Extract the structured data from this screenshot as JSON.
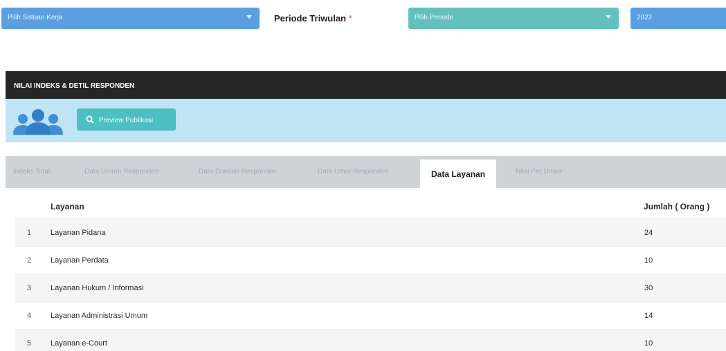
{
  "filters": {
    "unit_select": "Pilih Satuan Kerja",
    "period_label": "Periode Triwulan",
    "required_mark": "*",
    "period_select": "Pilih Periode",
    "year_select": "2022"
  },
  "panel": {
    "title": "NILAI INDEKS & DETIL RESPONDEN",
    "preview_button": "Preview Publikasi"
  },
  "tabs": [
    {
      "label": "Indeks Total"
    },
    {
      "label": "Data Umum Responden"
    },
    {
      "label": "Data Domisili Responden"
    },
    {
      "label": "Data Umur Responden"
    },
    {
      "label": "Data Layanan"
    },
    {
      "label": "Nilai Per Unsur"
    }
  ],
  "table": {
    "headers": {
      "name": "Layanan",
      "count": "Jumlah ( Orang )"
    },
    "rows": [
      {
        "no": "1",
        "name": "Layanan Pidana",
        "count": "24"
      },
      {
        "no": "2",
        "name": "Layanan Perdata",
        "count": "10"
      },
      {
        "no": "3",
        "name": "Layanan Hukum / Informasi",
        "count": "30"
      },
      {
        "no": "4",
        "name": "Layanan Administrasi Umum",
        "count": "14"
      },
      {
        "no": "5",
        "name": "Layanan e-Court",
        "count": "10"
      }
    ]
  },
  "icons": {
    "users": "users-icon",
    "search": "search-icon",
    "caret": "chevron-down-icon"
  },
  "colors": {
    "select_blue": "#5a9fe2",
    "select_teal": "#63c1bd",
    "header_dark": "#262626",
    "bar_light_blue": "#bfe4f4",
    "button_teal": "#4bbfc1"
  }
}
